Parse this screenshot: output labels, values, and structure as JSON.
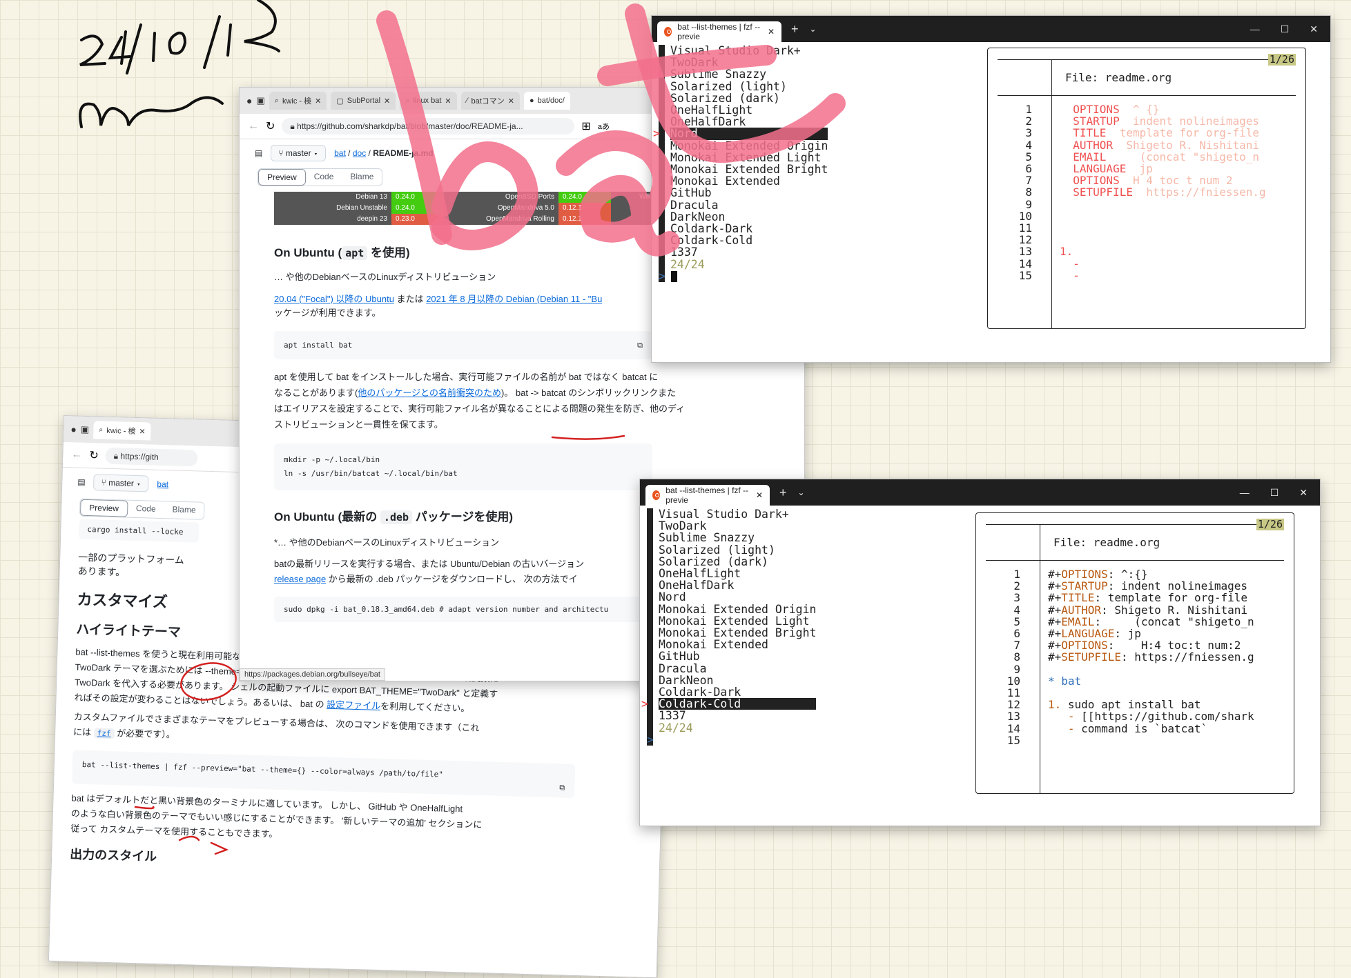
{
  "handwriting": {
    "date": "24/10/1",
    "big_word": "bat"
  },
  "browser_main": {
    "tabs": [
      "kwic - 検",
      "SubPortal",
      "linux bat",
      "batコマン",
      "bat/doc/"
    ],
    "url": "https://github.com/sharkdp/bat/blob/master/doc/README-ja...",
    "addr_extra": "aあ",
    "branch": "master",
    "breadcrumb": {
      "repo": "bat",
      "dir": "doc",
      "file": "README-ja.md",
      "sep": "/"
    },
    "view_tabs": [
      "Preview",
      "Code",
      "Blame"
    ],
    "versions": [
      {
        "name": "Debian 13",
        "ver": "0.24.0",
        "ok": true,
        "name2": "OpenBSD Ports",
        "ver2": "0.24.0",
        "ok2": true
      },
      {
        "name": "Debian Unstable",
        "ver": "0.24.0",
        "ok": true,
        "name2": "OpenMandriva 5.0",
        "ver2": "0.12.1",
        "ok2": false
      },
      {
        "name": "deepin 23",
        "ver": "0.23.0",
        "ok": false,
        "name2": "OpenMandriva Rolling",
        "ver2": "0.12.1",
        "ok2": false
      }
    ],
    "versions_cut": "Wiki",
    "h_apt_a": "On Ubuntu (",
    "h_apt_code": "apt",
    "h_apt_b": " を使用)",
    "p_debian": "… や他のDebianベースのLinuxディストリビューション",
    "p_link1": "20.04 (\"Focal\") 以降の Ubuntu",
    "p_mid": " または ",
    "p_link2": "2021 年 8 月以降の Debian (Debian 11 - \"Bu",
    "p_tail": "ッケージが利用できます。",
    "code_apt": "apt install bat",
    "p2_line1": "apt を使用して bat をインストールした場合、実行可能ファイルの名前が bat ではなく batcat に",
    "p2_line2a": "なることがあります(",
    "p2_link": "他のパッケージとの名前衝突のため",
    "p2_line2b": ")。 bat -> batcat のシンボリックリンクまた",
    "p2_line3": "はエイリアスを設定することで、実行可能ファイル名が異なることによる問題の発生を防ぎ、他のディ",
    "p2_line4": "ストリビューションと一貫性を保てます。",
    "code_mkdir": "mkdir -p ~/.local/bin",
    "code_ln": "ln -s /usr/bin/batcat ~/.local/bin/bat",
    "h_deb_a": "On Ubuntu (最新の ",
    "h_deb_code": ".deb",
    "h_deb_b": " パッケージを使用)",
    "p3": "*… や他のDebianベースのLinuxディストリビューション",
    "p4_line1": "batの最新リリースを実行する場合、または Ubuntu/Debian の古いバージョン",
    "p4_link": "release page",
    "p4_line2": " から最新の .deb パッケージをダウンロードし、 次の方法でイ",
    "code_dpkg": "sudo dpkg -i bat_0.18.3_amd64.deb  # adapt version number and architectu",
    "status_url": "https://packages.debian.org/bullseye/bat"
  },
  "browser_back": {
    "tab": "kwic - 検",
    "url": "https://gith",
    "branch": "master",
    "crumb": "bat",
    "view_tabs": [
      "Preview",
      "Code",
      "Blame"
    ],
    "code_cargo": "cargo install --locke",
    "p_platform": "一部のプラットフォーム",
    "p_platform2": "あります。",
    "h_custom": "カスタマイズ",
    "h_theme": "ハイライトテーマ",
    "t1": "bat --list-themes を使うと現在利用可能なシンタックスハイライトのテーマを入手できます。",
    "t2": "TwoDark テーマを選ぶためには --theme=TwoDark オプションをつけるか BAT_THEME という環境変数に",
    "t3": "TwoDark を代入する必要があります。 シェルの起動ファイルに export BAT_THEME=\"TwoDark\" と定義す",
    "t4a": "ればその設定が変わることはないでしょう。あるいは、 bat の ",
    "t4_link": "設定ファイル",
    "t4b": "を利用してください。",
    "t5": "カスタムファイルでさまざまなテーマをプレビューする場合は、 次のコマンドを使用できます（これ",
    "t6a": "には ",
    "t6_code": "fzf",
    "t6b": " が必要です）。",
    "code_fzf": "bat --list-themes | fzf --preview=\"bat --theme={} --color=always /path/to/file\"",
    "t7": "bat はデフォルトだと黒い背景色のターミナルに適しています。 しかし、 GitHub や OneHalfLight",
    "t8": "のような白い背景色のテーマでもいい感じにすることができます。 '新しいテーマの追加' セクションに",
    "t9": "従って カスタムテーマを使用することもできます。",
    "h_output": "出力のスタイル"
  },
  "terminals": {
    "title": "bat --list-themes | fzf --previe",
    "plus": "+",
    "themes": [
      "Visual Studio Dark+",
      "TwoDark",
      "Sublime Snazzy",
      "Solarized (light)",
      "Solarized (dark)",
      "OneHalfLight",
      "OneHalfDark",
      "Nord",
      "Monokai Extended Origin",
      "Monokai Extended Light",
      "Monokai Extended Bright",
      "Monokai Extended",
      "GitHub",
      "Dracula",
      "DarkNeon",
      "Coldark-Dark",
      "Coldark-Cold",
      "1337"
    ],
    "count": "24/24",
    "prompt": ">",
    "marker": ">",
    "file_header": "File: readme.org",
    "page": "1/26",
    "line_numbers": [
      "1",
      "2",
      "3",
      "4",
      "5",
      "6",
      "7",
      "8",
      "9",
      "10",
      "11",
      "12",
      "13",
      "14",
      "15"
    ],
    "top": {
      "keys": [
        "OPTIONS",
        "STARTUP",
        "TITLE",
        "AUTHOR",
        "EMAIL",
        "LANGUAGE",
        "OPTIONS",
        "SETUPFILE"
      ],
      "vals": [
        "^ {}",
        "indent nolineimages",
        "template for org-file",
        "Shigeto R. Nishitani",
        "   (concat \"shigeto_n",
        "jp",
        "H 4 toc t num 2",
        "https://fniessen.g"
      ],
      "l13": "1.",
      "l14": "  -",
      "l15": "  -"
    },
    "bottom": {
      "prefix": "#+",
      "keys": [
        "OPTIONS",
        "STARTUP",
        "TITLE",
        "AUTHOR",
        "EMAIL",
        "LANGUAGE",
        "OPTIONS",
        "SETUPFILE"
      ],
      "vals": [
        "^:{}",
        "indent nolineimages",
        "template for org-file",
        "Shigeto R. Nishitani",
        "    (concat \"shigeto_n",
        "jp",
        "   H:4 toc:t num:2",
        "https://fniessen.g"
      ],
      "l11_star": "*",
      "l11_text": "bat",
      "l13_num": "1.",
      "l13_text": "sudo apt install bat",
      "l14_dash": "   -",
      "l14_text": "[[https://github.com/shark",
      "l15_dash": "   -",
      "l15_text": "command is `batcat`"
    }
  }
}
